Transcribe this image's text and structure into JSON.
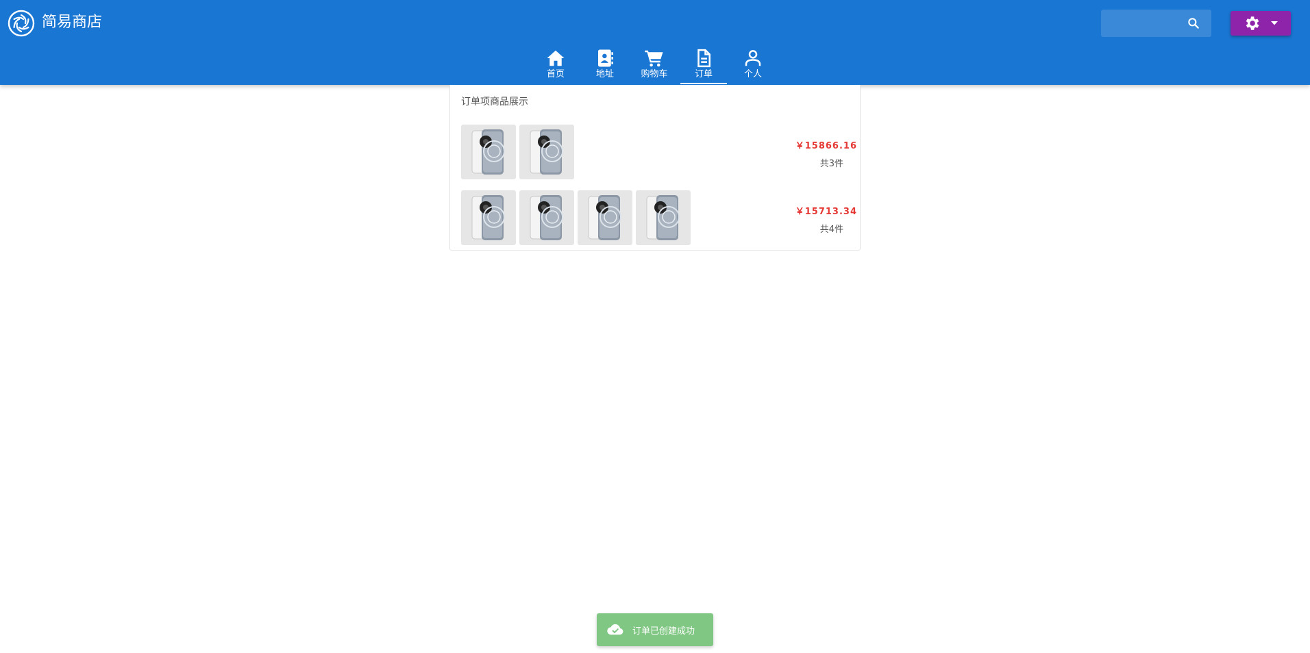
{
  "header": {
    "brand": "简易商店",
    "search": {
      "placeholder": "",
      "value": "",
      "icon": "search-icon"
    },
    "settings": {
      "icon": "gear-icon",
      "dropdown_icon": "caret-down-icon",
      "color": "#8e24aa"
    },
    "color": "#1976d2"
  },
  "nav": {
    "tabs": [
      {
        "label": "首页",
        "icon": "home-icon"
      },
      {
        "label": "地址",
        "icon": "contact-book-icon"
      },
      {
        "label": "购物车",
        "icon": "cart-icon"
      },
      {
        "label": "订单",
        "icon": "document-icon",
        "active": true
      },
      {
        "label": "个人",
        "icon": "user-icon"
      }
    ]
  },
  "main": {
    "card_title": "订单项商品展示",
    "orders": [
      {
        "price": "￥15866.16",
        "count": "共3件",
        "thumbnails": 2
      },
      {
        "price": "￥15713.34",
        "count": "共4件",
        "thumbnails": 4
      }
    ],
    "price_color": "#e53935"
  },
  "toast": {
    "message": "订单已创建成功",
    "icon": "cloud-check-icon",
    "color": "#81c784"
  }
}
